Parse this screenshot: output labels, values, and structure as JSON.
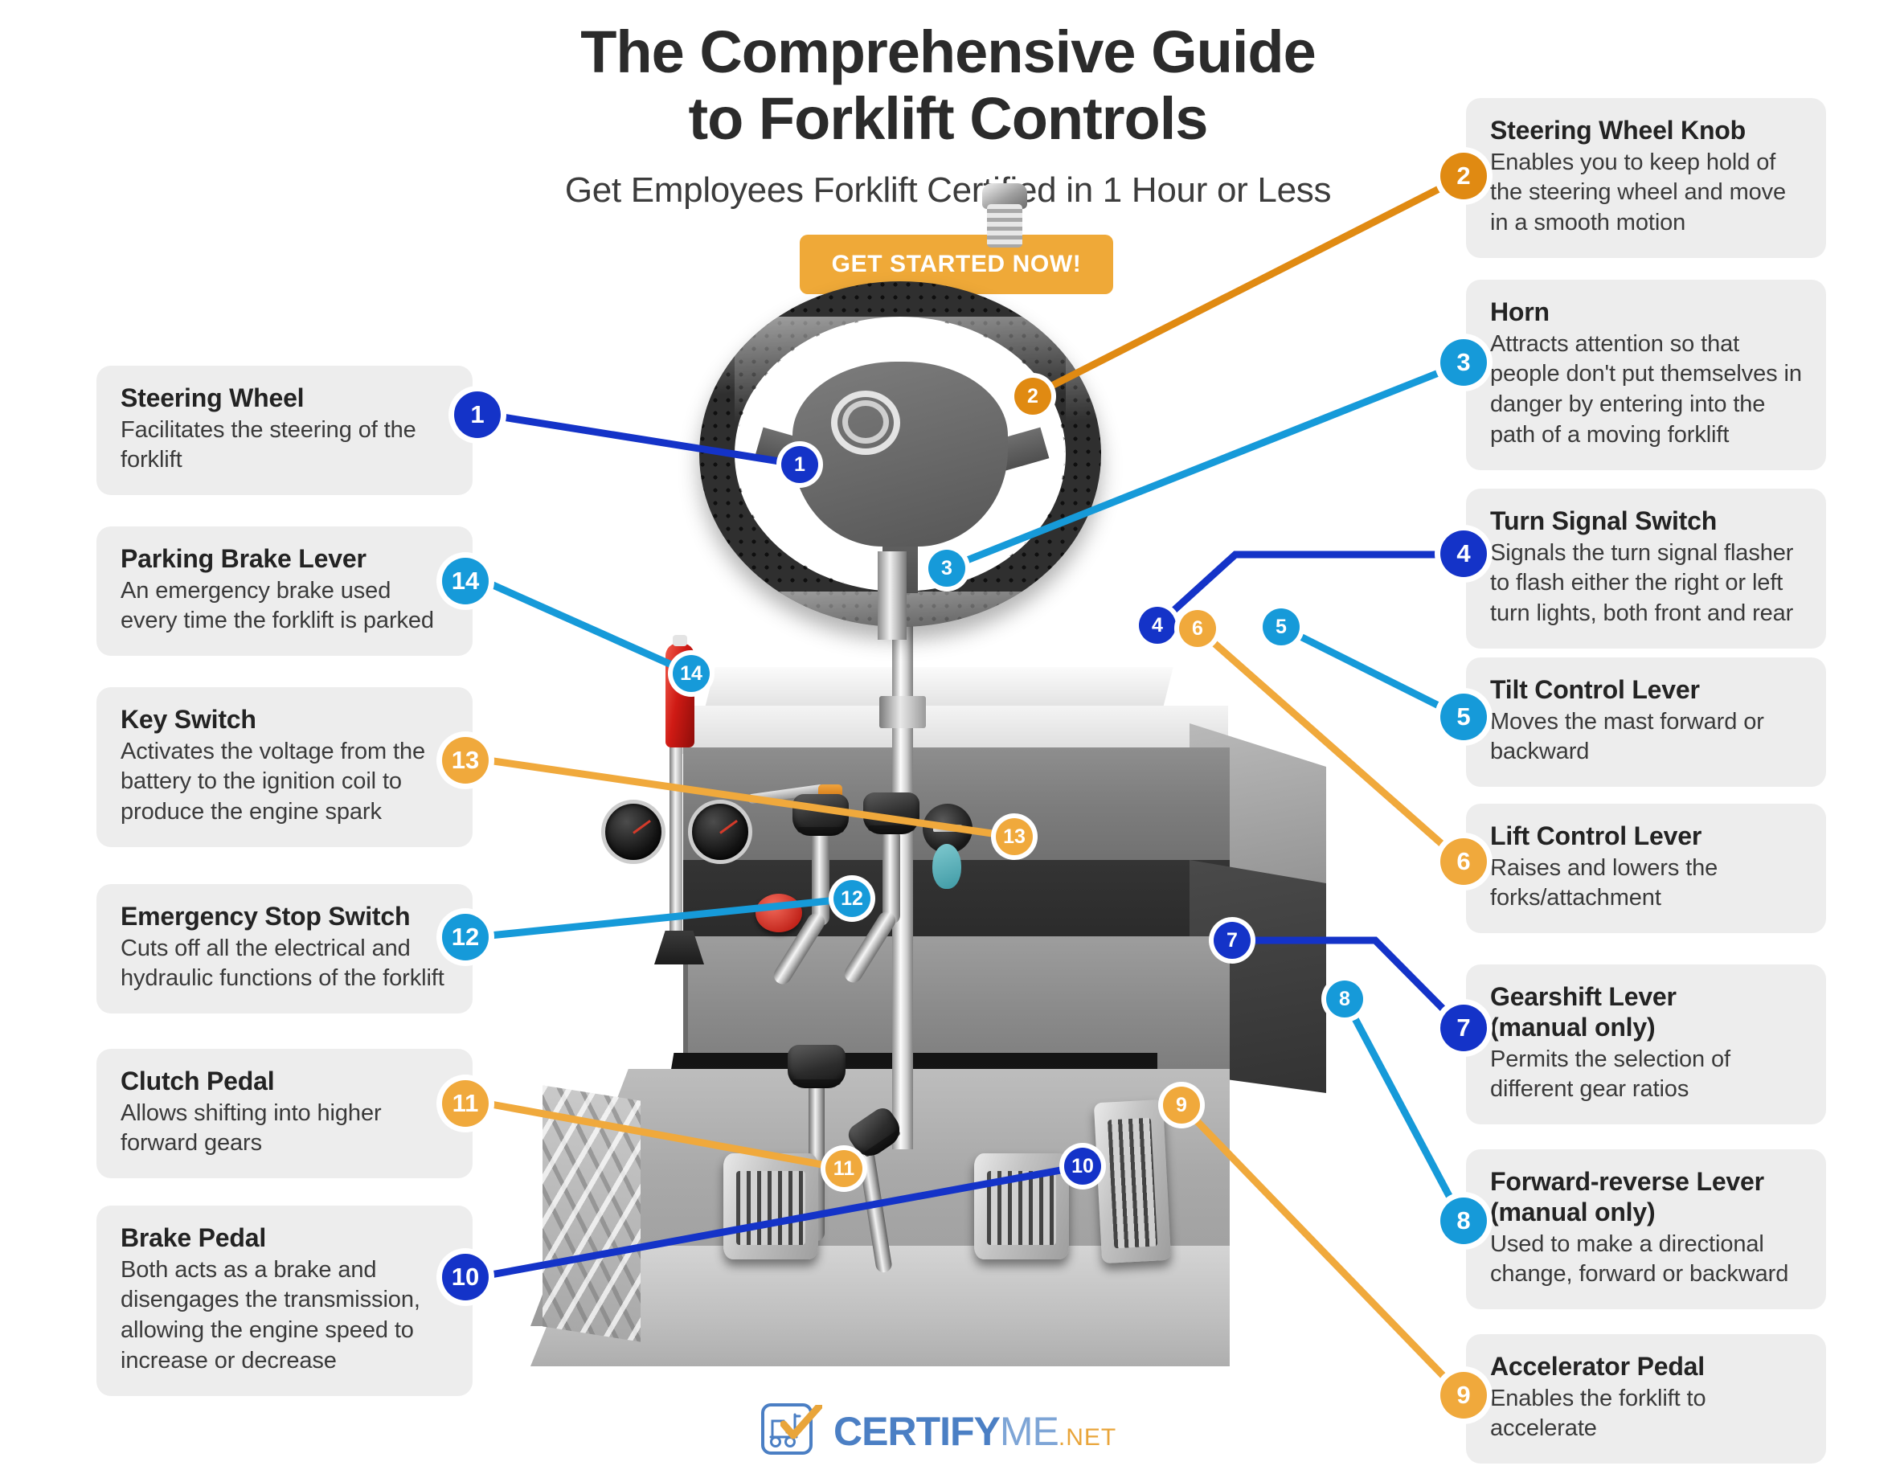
{
  "header": {
    "title_line1": "The Comprehensive Guide",
    "title_line2": "to Forklift Controls",
    "subtitle": "Get Employees Forklift Certified in 1 Hour or Less",
    "cta_label": "GET STARTED NOW!"
  },
  "colors": {
    "navy": "#1433c8",
    "blue": "#169ad9",
    "orange": "#f0a93c",
    "orange_dark": "#e08a12",
    "card_bg": "#ededed",
    "page_bg": "#ffffff",
    "title": "#2b2b2b"
  },
  "cards_left": [
    {
      "number": "1",
      "color": "navy",
      "title": "Steering Wheel",
      "desc": "Facilitates the steering of the forklift"
    },
    {
      "number": "14",
      "color": "blue",
      "title": "Parking Brake Lever",
      "desc": "An emergency brake used every time the forklift is parked"
    },
    {
      "number": "13",
      "color": "orange",
      "title": "Key Switch",
      "desc": "Activates the voltage from the battery to the ignition coil to produce the engine spark"
    },
    {
      "number": "12",
      "color": "blue",
      "title": "Emergency Stop Switch",
      "desc": "Cuts off all the electrical and hydraulic functions of the forklift"
    },
    {
      "number": "11",
      "color": "orange",
      "title": "Clutch Pedal",
      "desc": "Allows shifting into higher forward gears"
    },
    {
      "number": "10",
      "color": "navy",
      "title": "Brake Pedal",
      "desc": "Both acts as a brake and disengages the transmission, allowing the engine speed to increase or decrease"
    }
  ],
  "cards_right": [
    {
      "number": "2",
      "color": "orange_dark",
      "title": "Steering Wheel Knob",
      "title2": "",
      "desc": "Enables you to keep hold of the steering wheel and move in a smooth motion"
    },
    {
      "number": "3",
      "color": "blue",
      "title": "Horn",
      "title2": "",
      "desc": "Attracts attention so that people don't put themselves in danger by entering into the path of a moving forklift"
    },
    {
      "number": "4",
      "color": "navy",
      "title": "Turn Signal Switch",
      "title2": "",
      "desc": "Signals the turn signal flasher to flash either the right or left turn lights, both front and rear"
    },
    {
      "number": "5",
      "color": "blue",
      "title": "Tilt Control Lever",
      "title2": "",
      "desc": "Moves the mast forward or backward"
    },
    {
      "number": "6",
      "color": "orange",
      "title": "Lift Control Lever",
      "title2": "",
      "desc": "Raises and lowers the forks/attachment"
    },
    {
      "number": "7",
      "color": "navy",
      "title": "Gearshift Lever",
      "title2": "(manual only)",
      "desc": "Permits the selection of different gear ratios"
    },
    {
      "number": "8",
      "color": "blue",
      "title": "Forward-reverse Lever",
      "title2": "(manual only)",
      "desc": "Used to make a directional change, forward or backward"
    },
    {
      "number": "9",
      "color": "orange",
      "title": "Accelerator Pedal",
      "title2": "",
      "desc": "Enables the forklift to accelerate"
    }
  ],
  "diagram_markers": [
    {
      "number": "1",
      "color": "navy",
      "label": "steering-wheel-rim"
    },
    {
      "number": "2",
      "color": "orange_dark",
      "label": "steering-wheel-knob"
    },
    {
      "number": "3",
      "color": "blue",
      "label": "horn-button"
    },
    {
      "number": "4",
      "color": "navy",
      "label": "turn-signal-stalk"
    },
    {
      "number": "5",
      "color": "blue",
      "label": "tilt-control-lever"
    },
    {
      "number": "6",
      "color": "orange",
      "label": "lift-control-lever"
    },
    {
      "number": "7",
      "color": "navy",
      "label": "gearshift-lever"
    },
    {
      "number": "8",
      "color": "blue",
      "label": "forward-reverse-lever"
    },
    {
      "number": "9",
      "color": "orange",
      "label": "accelerator-pedal"
    },
    {
      "number": "10",
      "color": "navy",
      "label": "brake-pedal"
    },
    {
      "number": "11",
      "color": "orange",
      "label": "clutch-pedal"
    },
    {
      "number": "12",
      "color": "blue",
      "label": "emergency-stop-button"
    },
    {
      "number": "13",
      "color": "orange",
      "label": "key-switch"
    },
    {
      "number": "14",
      "color": "blue",
      "label": "parking-brake-lever"
    }
  ],
  "footer": {
    "logo_certify": "CERTIFY",
    "logo_me": "ME",
    "logo_net": ".NET"
  }
}
